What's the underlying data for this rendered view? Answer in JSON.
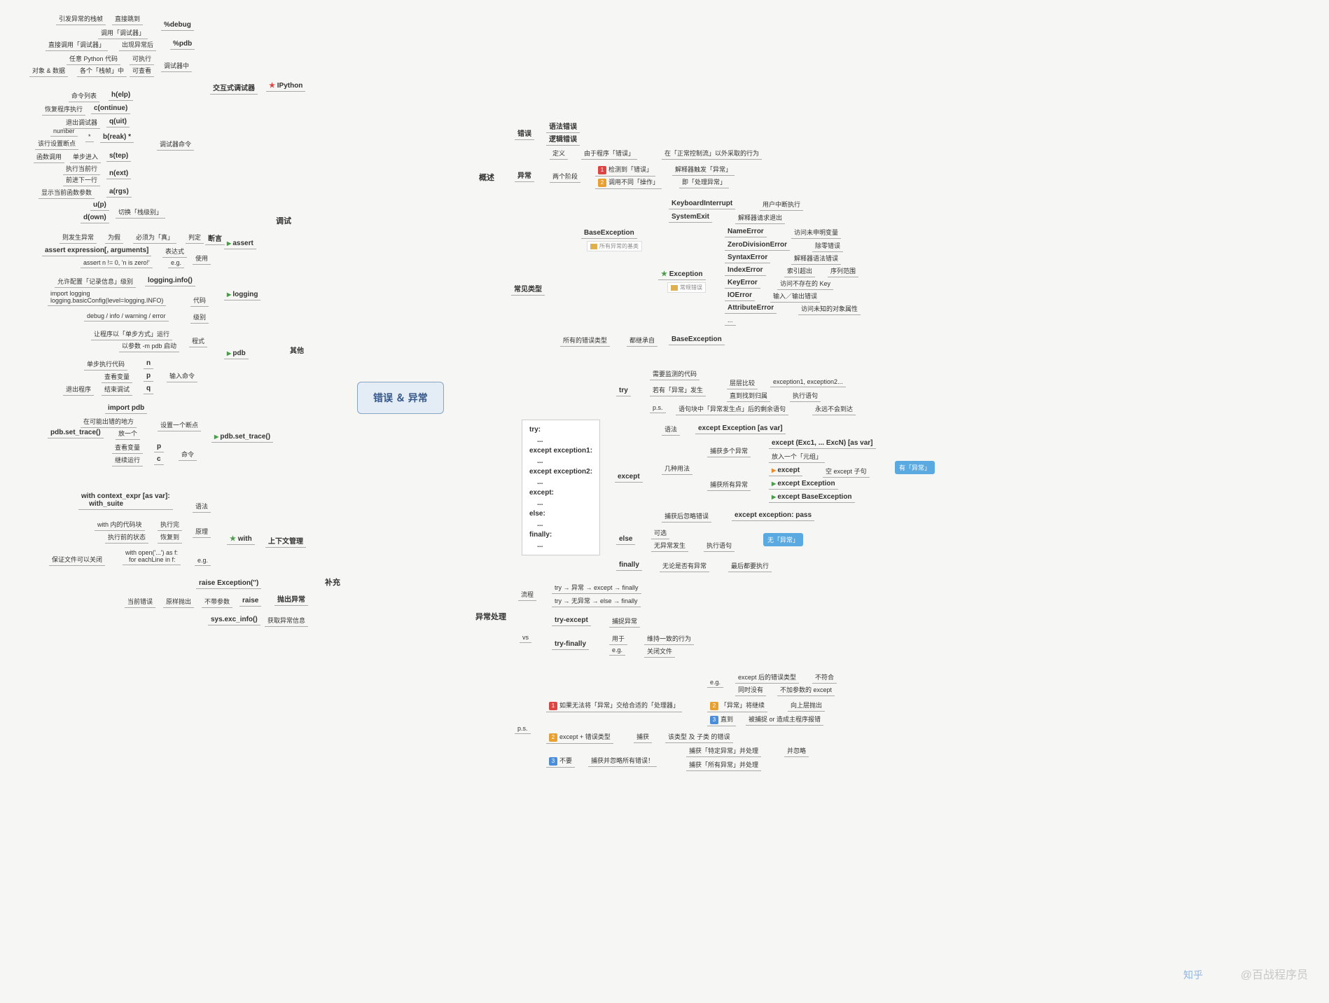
{
  "center": "错误 ＆ 异常",
  "left": {
    "debug": {
      "title": "调试",
      "interactive": {
        "title": "交互式调试器",
        "ipython": "IPython",
        "pct_debug": {
          "label": "%debug",
          "a": "直接跳到",
          "a2": "引发异常的栈帧",
          "b": "调用「调试器」"
        },
        "pct_pdb": {
          "label": "%pdb",
          "a": "出现异常后",
          "a2": "直接调用「调试器」"
        },
        "debugger_in": {
          "label": "调试器中",
          "r1a": "可执行",
          "r1b": "任意 Python 代码",
          "r2a": "可查看",
          "r2b": "各个「栈帧」中",
          "r2c": "对象 & 数据"
        }
      },
      "cmds": {
        "label": "调试器命令",
        "help": {
          "cmd": "h(elp)",
          "desc": "命令列表"
        },
        "cont": {
          "cmd": "c(ontinue)",
          "desc": "恢复程序执行"
        },
        "quit": {
          "cmd": "q(uit)",
          "desc": "退出调试器"
        },
        "brk": {
          "cmd": "b(reak) *",
          "s": "*",
          "d1": "number",
          "d2": "该行设置断点"
        },
        "step": {
          "cmd": "s(tep)",
          "d1": "单步进入",
          "d2": "函数调用"
        },
        "next": {
          "cmd": "n(ext)",
          "d1": "执行当前行",
          "d2": "前进下一行"
        },
        "args": {
          "cmd": "a(rgs)",
          "d": "显示当前函数参数"
        },
        "up": {
          "cmd": "u(p)"
        },
        "down": {
          "cmd": "d(own)",
          "d": "切换「栈级别」"
        }
      },
      "other": {
        "label": "其他",
        "assert": {
          "label": "assert",
          "judge": {
            "label": "判定",
            "t": "断言",
            "a": "必须为「真」",
            "b": "为假",
            "c": "则发生异常"
          },
          "use": {
            "label": "使用",
            "expr": "表达式",
            "expr_v": "assert expression[, arguments]",
            "eg": "e.g.",
            "eg_v": "assert n != 0, 'n is zero!'"
          }
        },
        "logging": {
          "label": "logging",
          "info": {
            "label": "logging.info()",
            "d": "允许配置「记录信息」级别"
          },
          "code_l": "代码",
          "code_v": "import logging\nlogging.basicConfig(level=logging.INFO)",
          "lvl_l": "级别",
          "lvl_v": "debug / info / warning / error"
        },
        "pdb": {
          "label": "pdb",
          "way": {
            "label": "程式",
            "a": "以参数 -m pdb 启动",
            "b": "让程序以「单步方式」运行"
          },
          "in": {
            "label": "输入命令",
            "n": {
              "c": "n",
              "d": "单步执行代码"
            },
            "p": {
              "c": "p",
              "d": "查看变量"
            },
            "q": {
              "c": "q",
              "a": "结束调试",
              "b": "退出程序"
            }
          }
        },
        "set_trace": {
          "label": "pdb.set_trace()",
          "bp": {
            "label": "设置一个断点",
            "a": "import pdb",
            "b": "在可能出错的地方",
            "c": "放一个",
            "d": "pdb.set_trace()"
          },
          "cmd": {
            "label": "命令",
            "p": {
              "c": "p",
              "d": "查看变量"
            },
            "c": {
              "c": "c",
              "d": "继续运行"
            }
          }
        }
      }
    },
    "supp": {
      "title": "补充",
      "ctx": {
        "label": "上下文管理",
        "with": "with",
        "syn": {
          "label": "语法",
          "v": "with context_expr [as var]:\n    with_suite"
        },
        "prin": {
          "label": "原理",
          "a": "执行完",
          "a2": "with 内的代码块",
          "b": "恢复到",
          "b2": "执行前的状态"
        },
        "eg": {
          "label": "e.g.",
          "v": "with open('...') as f:\n  for eachLine in f:",
          "d": "保证文件可以关闭"
        }
      },
      "raise": {
        "label": "抛出异常",
        "ex": "raise Exception('')",
        "r": {
          "label": "raise",
          "a": "不带参数",
          "b": "原样抛出",
          "c": "当前错误"
        }
      },
      "sys": {
        "label": "获取异常信息",
        "v": "sys.exc_info()"
      }
    }
  },
  "right": {
    "overview": {
      "title": "概述",
      "err": {
        "label": "错误",
        "a": "语法错误",
        "b": "逻辑错误"
      },
      "ex": {
        "label": "异常",
        "def": {
          "label": "定义",
          "a": "由于程序「错误」",
          "b": "在「正常控制流」以外采取的行为"
        },
        "ph": {
          "label": "两个阶段",
          "p1a": "检测到「错误」",
          "p1b": "解释器触发「异常」",
          "p2a": "调用不同「操作」",
          "p2b": "即「处理异常」"
        }
      },
      "types": {
        "label": "常见类型",
        "base": {
          "label": "BaseException",
          "tag": "所有异常的基类",
          "ki": {
            "n": "KeyboardInterrupt",
            "d": "用户中断执行"
          },
          "se": {
            "n": "SystemExit",
            "d": "解释器请求退出"
          }
        },
        "ex": {
          "label": "Exception",
          "tag": "常规错误",
          "ne": {
            "n": "NameError",
            "d": "访问未申明变量"
          },
          "zd": {
            "n": "ZeroDivisionError",
            "d": "除零错误"
          },
          "sy": {
            "n": "SyntaxError",
            "d": "解释器语法错误"
          },
          "ix": {
            "n": "IndexError",
            "d": "索引超出",
            "d2": "序列范围"
          },
          "ke": {
            "n": "KeyError",
            "d": "访问不存在的 Key"
          },
          "io": {
            "n": "IOError",
            "d": "输入／输出错误"
          },
          "ae": {
            "n": "AttributeError",
            "d": "访问未知的对象属性"
          },
          "more": "..."
        },
        "inherit": {
          "a": "所有的错误类型",
          "b": "都继承自",
          "c": "BaseException"
        }
      }
    },
    "handle": {
      "title": "异常处理",
      "syntax": {
        "label": "语法",
        "code": "try:\n    ...\nexcept exception1:\n    ...\nexcept exception2:\n    ...\nexcept:\n    ...\nelse:\n    ...\nfinally:\n    ..."
      },
      "try": {
        "label": "try",
        "a": "需要监测的代码",
        "b1": "若有「异常」发生",
        "b2a": "层层比较",
        "b2b": "exception1, exception2...",
        "b3a": "直到找到归属",
        "b3b": "执行语句",
        "psa": "p.s.",
        "psb": "语句块中「异常发生点」后的剩余语句",
        "psc": "永远不会到达"
      },
      "except": {
        "label": "except",
        "syn": "语法",
        "syn_v": "except Exception [as var]",
        "multi": {
          "label": "几种用法",
          "m": {
            "label": "捕获多个异常",
            "v": "except (Exc1, ... ExcN) [as var]",
            "d": "放入一个「元组」"
          },
          "all": {
            "label": "捕获所有异常",
            "a": "except",
            "ad": "空 except 子句",
            "b": "except Exception",
            "c": "except BaseException"
          }
        },
        "ign": {
          "a": "捕获后忽略错误",
          "b": "except exception: pass"
        }
      },
      "else": {
        "label": "else",
        "a": "可选",
        "b": "无异常发生",
        "c": "执行语句"
      },
      "finally": {
        "label": "finally",
        "a": "无论是否有异常",
        "b": "最后都要执行"
      },
      "flow": {
        "label": "流程",
        "a": "try → 异常 → except → finally",
        "b": "try → 无异常 → else → finally"
      },
      "vs": {
        "label": "vs",
        "te": {
          "n": "try-except",
          "d": "捕捉异常"
        },
        "tf": {
          "n": "try-finally",
          "a": "用于",
          "b": "维持一致的行为",
          "c": "e.g.",
          "d": "关闭文件"
        }
      },
      "ps": {
        "label": "p.s.",
        "a": {
          "t": "如果无法将「异常」交给合适的「处理器」",
          "eg": {
            "a": "e.g.",
            "b": "except 后的错误类型",
            "c": "不符合",
            "d": "同时没有",
            "e": "不加参数的 except"
          },
          "th": {
            "a": "「异常」将继续",
            "b": "向上层抛出"
          },
          "un": {
            "a": "直到",
            "b": "被捕捉 or 造成主程序报错"
          }
        },
        "b": {
          "a": "except + 错误类型",
          "b": "捕获",
          "c": "该类型 及 子类 的错误"
        },
        "c": {
          "a": "不要",
          "b": "捕获并忽略所有错误！",
          "c1": "捕获「特定异常」并处理",
          "c2": "并忽略",
          "d": "捕获「所有异常」并处理"
        }
      }
    }
  },
  "callouts": {
    "has": "有「异常」",
    "none": "无「异常」"
  },
  "watermark": {
    "logo": "知乎",
    "text": "@百战程序员"
  }
}
